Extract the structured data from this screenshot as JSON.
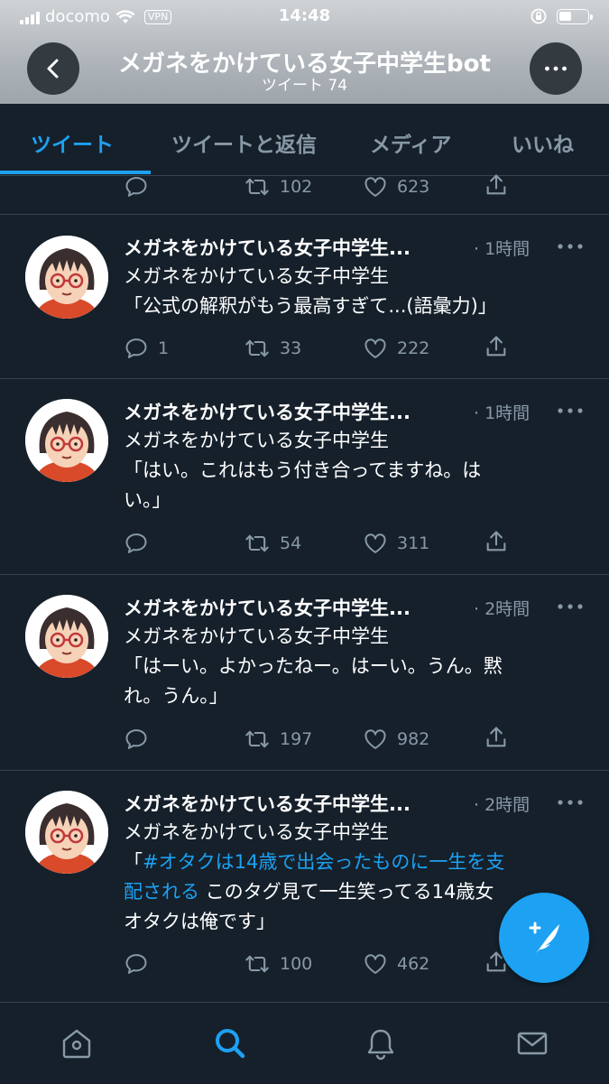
{
  "status_bar": {
    "carrier": "docomo",
    "vpn": "VPN",
    "time": "14:48",
    "battery_level": 0.45
  },
  "header": {
    "title": "メガネをかけている女子中学生bot",
    "subtitle": "ツイート 74",
    "back_icon": "chevron-left-icon",
    "more_icon": "more-icon"
  },
  "tabs": [
    {
      "label": "ツイート",
      "active": true
    },
    {
      "label": "ツイートと返信",
      "active": false
    },
    {
      "label": "メディア",
      "active": false
    },
    {
      "label": "いいね",
      "active": false
    }
  ],
  "partial_actions": {
    "retweets": "102",
    "likes": "623"
  },
  "tweets": [
    {
      "name": "メガネをかけている女子中学生...",
      "time": "· 1時間",
      "line1": "メガネをかけている女子中学生",
      "line2": "「公式の解釈がもう最高すぎて...(語彙力)」",
      "replies": "1",
      "retweets": "33",
      "likes": "222"
    },
    {
      "name": "メガネをかけている女子中学生...",
      "time": "· 1時間",
      "line1": "メガネをかけている女子中学生",
      "line2": "「はい。これはもう付き合ってますね。は",
      "line3": "い。」",
      "replies": "",
      "retweets": "54",
      "likes": "311"
    },
    {
      "name": "メガネをかけている女子中学生...",
      "time": "· 2時間",
      "line1": "メガネをかけている女子中学生",
      "line2": "「はーい。よかったねー。はーい。うん。黙",
      "line3": "れ。うん。」",
      "replies": "",
      "retweets": "197",
      "likes": "982"
    },
    {
      "name": "メガネをかけている女子中学生...",
      "time": "· 2時間",
      "line1": "メガネをかけている女子中学生",
      "hashtag": "#オタクは14歳で出会ったものに一生を支配される",
      "hashtag_a": "#オタクは14歳で出会ったものに一生を支",
      "hashtag_b": "配される",
      "rest": " このタグ見て一生笑ってる14歳女",
      "line4": "オタクは俺です」",
      "replies": "",
      "retweets": "100",
      "likes": "462"
    }
  ],
  "fab": {
    "icon": "compose-tweet-icon"
  },
  "bottom_nav": [
    {
      "icon": "home-icon",
      "active": false
    },
    {
      "icon": "search-icon",
      "active": true
    },
    {
      "icon": "notifications-icon",
      "active": false
    },
    {
      "icon": "messages-icon",
      "active": false
    }
  ],
  "colors": {
    "background": "#15202b",
    "accent": "#1da1f2",
    "muted": "#8899a6",
    "divider": "#38444d"
  }
}
